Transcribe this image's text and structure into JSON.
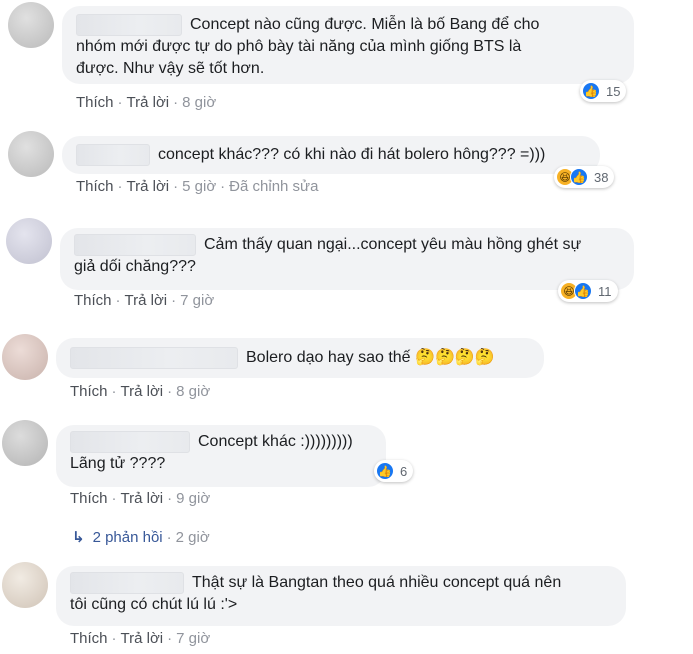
{
  "comments": [
    {
      "lines": [
        "Concept nào cũng được. Miễn là bố Bang để cho",
        "nhóm mới được tự do phô bày tài năng của mình giống BTS là",
        "được. Như vậy sẽ tốt hơn."
      ],
      "like": "Thích",
      "reply": "Trả lời",
      "time": "8 giờ",
      "edited": "",
      "reaction_icons": [
        "like-icon"
      ],
      "reaction_count": "15"
    },
    {
      "lines": [
        "concept khác??? có khi nào đi hát bolero hông??? =)))"
      ],
      "like": "Thích",
      "reply": "Trả lời",
      "time": "5 giờ",
      "edited": "Đã chỉnh sửa",
      "reaction_icons": [
        "haha-icon",
        "like-icon"
      ],
      "reaction_count": "38"
    },
    {
      "lines": [
        "Cảm thấy quan ngại...concept yêu màu hồng ghét sự",
        "giả dối chăng???"
      ],
      "like": "Thích",
      "reply": "Trả lời",
      "time": "7 giờ",
      "edited": "",
      "reaction_icons": [
        "haha-icon",
        "like-icon"
      ],
      "reaction_count": "11"
    },
    {
      "lines": [
        "Bolero dạo hay sao thế"
      ],
      "emoji": "🤔🤔🤔🤔",
      "like": "Thích",
      "reply": "Trả lời",
      "time": "8 giờ",
      "edited": "",
      "reaction_icons": [],
      "reaction_count": ""
    },
    {
      "lines": [
        "Concept khác :)))))))))",
        "Lãng tử ????"
      ],
      "like": "Thích",
      "reply": "Trả lời",
      "time": "9 giờ",
      "edited": "",
      "reaction_icons": [
        "like-icon"
      ],
      "reaction_count": "6"
    },
    {
      "lines": [
        "Thật sự là Bangtan theo quá nhiều concept quá nên",
        "tôi cũng có chút lú lú :'>"
      ],
      "like": "Thích",
      "reply": "Trả lời",
      "time": "7 giờ",
      "edited": "",
      "reaction_icons": [],
      "reaction_count": ""
    }
  ],
  "replies": {
    "label": "2 phản hồi",
    "time": "2 giờ"
  },
  "separator": "·",
  "colors": {
    "bubble": "#f2f3f5",
    "link": "#385898",
    "like": "#1877f2",
    "haha": "#f7b125"
  }
}
